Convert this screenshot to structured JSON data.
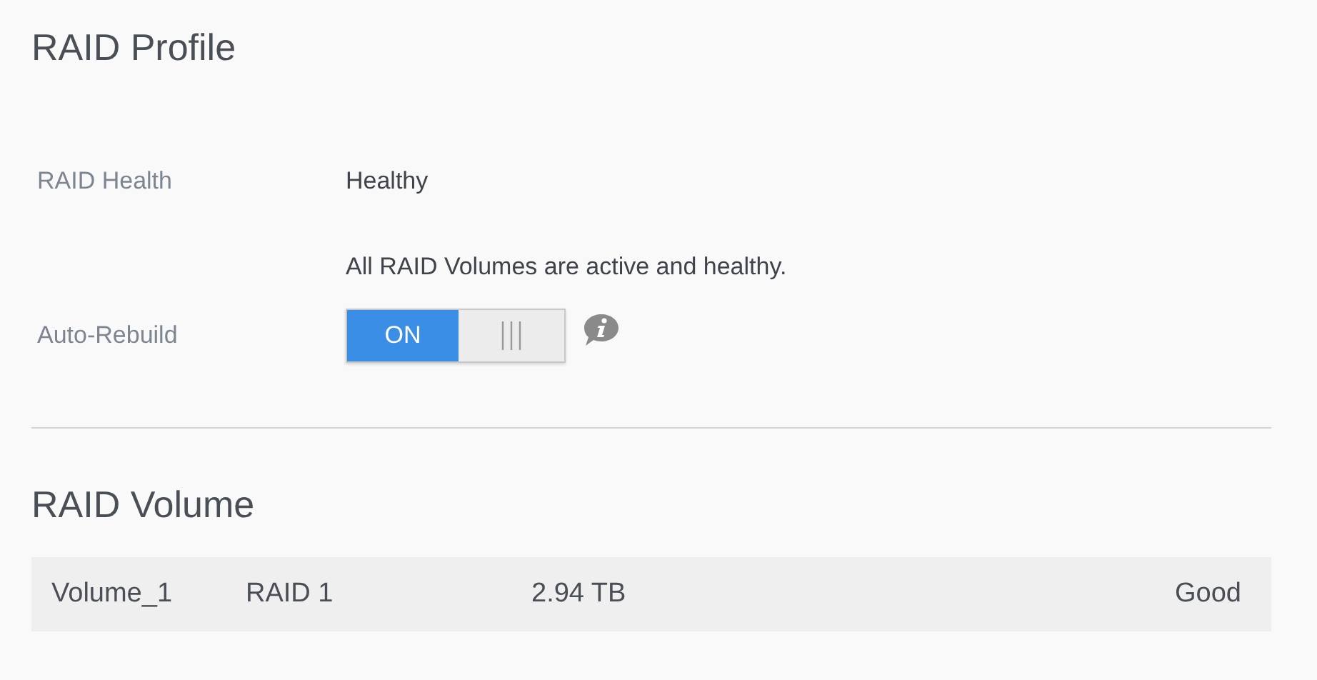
{
  "profile": {
    "title": "RAID Profile",
    "health": {
      "label": "RAID Health",
      "value": "Healthy",
      "message": "All RAID Volumes are active and healthy."
    },
    "auto_rebuild": {
      "label": "Auto-Rebuild",
      "toggle_label": "ON",
      "on": true
    }
  },
  "volume": {
    "title": "RAID Volume",
    "rows": [
      {
        "name": "Volume_1",
        "raid_level": "RAID 1",
        "size": "2.94 TB",
        "status": "Good"
      }
    ]
  }
}
